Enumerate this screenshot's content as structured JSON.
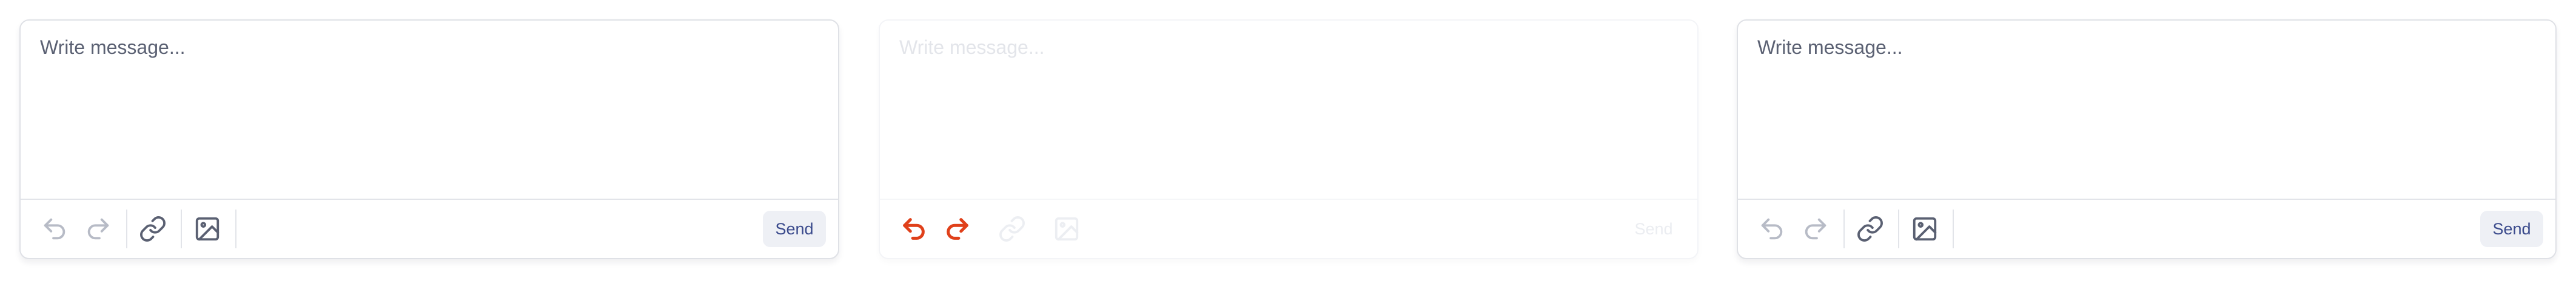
{
  "composers": [
    {
      "state": "default",
      "placeholder": "Write message...",
      "send_label": "Send",
      "toolbar_icons": [
        "undo-icon",
        "redo-icon",
        "link-icon",
        "image-icon"
      ]
    },
    {
      "state": "disabled",
      "placeholder": "Write message...",
      "send_label": "Send",
      "toolbar_icons": [
        "undo-icon",
        "redo-icon",
        "link-icon",
        "image-icon"
      ],
      "undo_redo_color": "#e0401a"
    },
    {
      "state": "default",
      "placeholder": "Write message...",
      "send_label": "Send",
      "toolbar_icons": [
        "undo-icon",
        "redo-icon",
        "link-icon",
        "image-icon"
      ]
    }
  ],
  "colors": {
    "send_text": "#3a4a8c",
    "send_background": "#eef0f5",
    "border": "#dfe1e6",
    "icon_active": "#5a6072",
    "icon_inactive": "#b7bbc6",
    "accent_red": "#e0401a"
  }
}
